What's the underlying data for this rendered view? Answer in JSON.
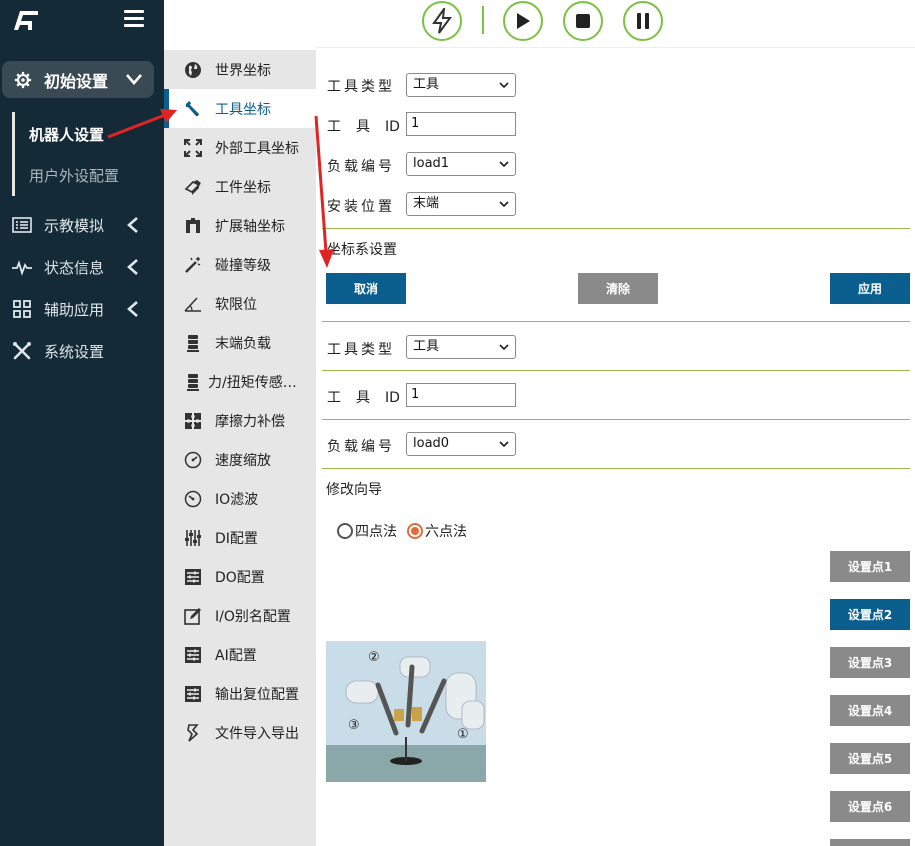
{
  "colors": {
    "nav_bg": "#142a36",
    "accent_blue": "#0a5f8f",
    "accent_green": "#7bc142",
    "gray_button": "#8a8a8a",
    "radio_active": "#e46a3a",
    "annotation_red": "#e02424"
  },
  "nav": {
    "logo_icon": "logo-icon",
    "menu_icon": "hamburger-icon",
    "init_settings": "初始设置",
    "sub_items": [
      "机器人设置",
      "用户外设配置"
    ],
    "items": [
      {
        "label": "示教模拟",
        "icon": "list-icon"
      },
      {
        "label": "状态信息",
        "icon": "pulse-icon"
      },
      {
        "label": "辅助应用",
        "icon": "grid-icon"
      },
      {
        "label": "系统设置",
        "icon": "tools-icon"
      }
    ]
  },
  "submenu": [
    {
      "label": "世界坐标",
      "icon": "globe-icon"
    },
    {
      "label": "工具坐标",
      "icon": "wrench-icon"
    },
    {
      "label": "外部工具坐标",
      "icon": "expand-icon"
    },
    {
      "label": "工件坐标",
      "icon": "eraser-icon"
    },
    {
      "label": "扩展轴坐标",
      "icon": "axis-icon"
    },
    {
      "label": "碰撞等级",
      "icon": "magic-wand-icon"
    },
    {
      "label": "软限位",
      "icon": "angle-icon"
    },
    {
      "label": "末端负载",
      "icon": "database-icon"
    },
    {
      "label": "力/扭矩传感…",
      "icon": "database-icon"
    },
    {
      "label": "摩擦力补偿",
      "icon": "puzzle-icon"
    },
    {
      "label": "速度缩放",
      "icon": "gauge-icon"
    },
    {
      "label": "IO滤波",
      "icon": "gauge-icon"
    },
    {
      "label": "DI配置",
      "icon": "sliders-icon"
    },
    {
      "label": "DO配置",
      "icon": "sliders-icon"
    },
    {
      "label": "I/O别名配置",
      "icon": "edit-icon"
    },
    {
      "label": "AI配置",
      "icon": "sliders-icon"
    },
    {
      "label": "输出复位配置",
      "icon": "sliders-icon"
    },
    {
      "label": "文件导入导出",
      "icon": "file-icon"
    }
  ],
  "toolbar": {
    "buttons": [
      "lightning-icon",
      "play-icon",
      "stop-icon",
      "pause-icon"
    ]
  },
  "form1": {
    "tool_type_label": "工具类型",
    "tool_type_value": "工具",
    "tool_id_label": "工具ID",
    "tool_id_value": "1",
    "load_no_label": "负载编号",
    "load_no_value": "load1",
    "mount_label": "安装位置",
    "mount_value": "末端",
    "coord_settings": "坐标系设置",
    "cancel": "取消",
    "clear": "清除",
    "apply": "应用"
  },
  "form2": {
    "tool_type_label": "工具类型",
    "tool_type_value": "工具",
    "tool_id_label": "工具ID",
    "tool_id_value": "1",
    "load_no_label": "负载编号",
    "load_no_value": "load0",
    "wizard": "修改向导",
    "four_point": "四点法",
    "six_point": "六点法",
    "selected": "六点法",
    "points": [
      "设置点1",
      "设置点2",
      "设置点3",
      "设置点4",
      "设置点5",
      "设置点6"
    ],
    "active_point": "设置点2",
    "image_markers": [
      "①",
      "②",
      "③"
    ]
  }
}
